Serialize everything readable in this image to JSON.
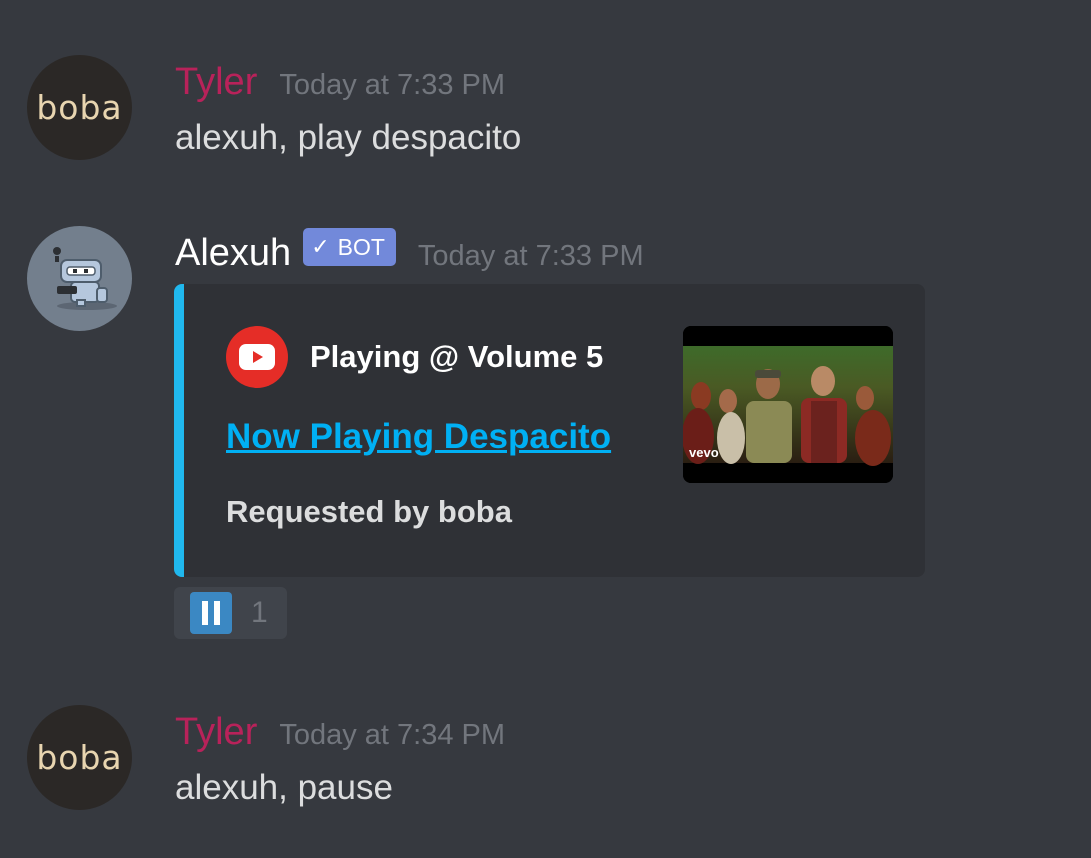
{
  "messages": [
    {
      "author": "Tyler",
      "avatar_text": "boba",
      "timestamp": "Today at 7:33 PM",
      "content": "alexuh, play despacito"
    },
    {
      "author": "Alexuh",
      "bot_tag": "BOT",
      "timestamp": "Today at 7:33 PM",
      "embed": {
        "author": "Playing @ Volume 5",
        "author_icon": "youtube-icon",
        "title": "Now Playing Despacito",
        "description": "Requested by boba",
        "thumbnail_watermark": "vevo",
        "accent_color": "#20b8ee"
      },
      "reaction": {
        "emoji": "pause-button-icon",
        "count": "1"
      }
    },
    {
      "author": "Tyler",
      "avatar_text": "boba",
      "timestamp": "Today at 7:34 PM",
      "content": "alexuh, pause"
    }
  ],
  "colors": {
    "background": "#36393f",
    "tyler_name": "#b8225a",
    "bot_tag": "#7289da",
    "link": "#00b0f4"
  }
}
